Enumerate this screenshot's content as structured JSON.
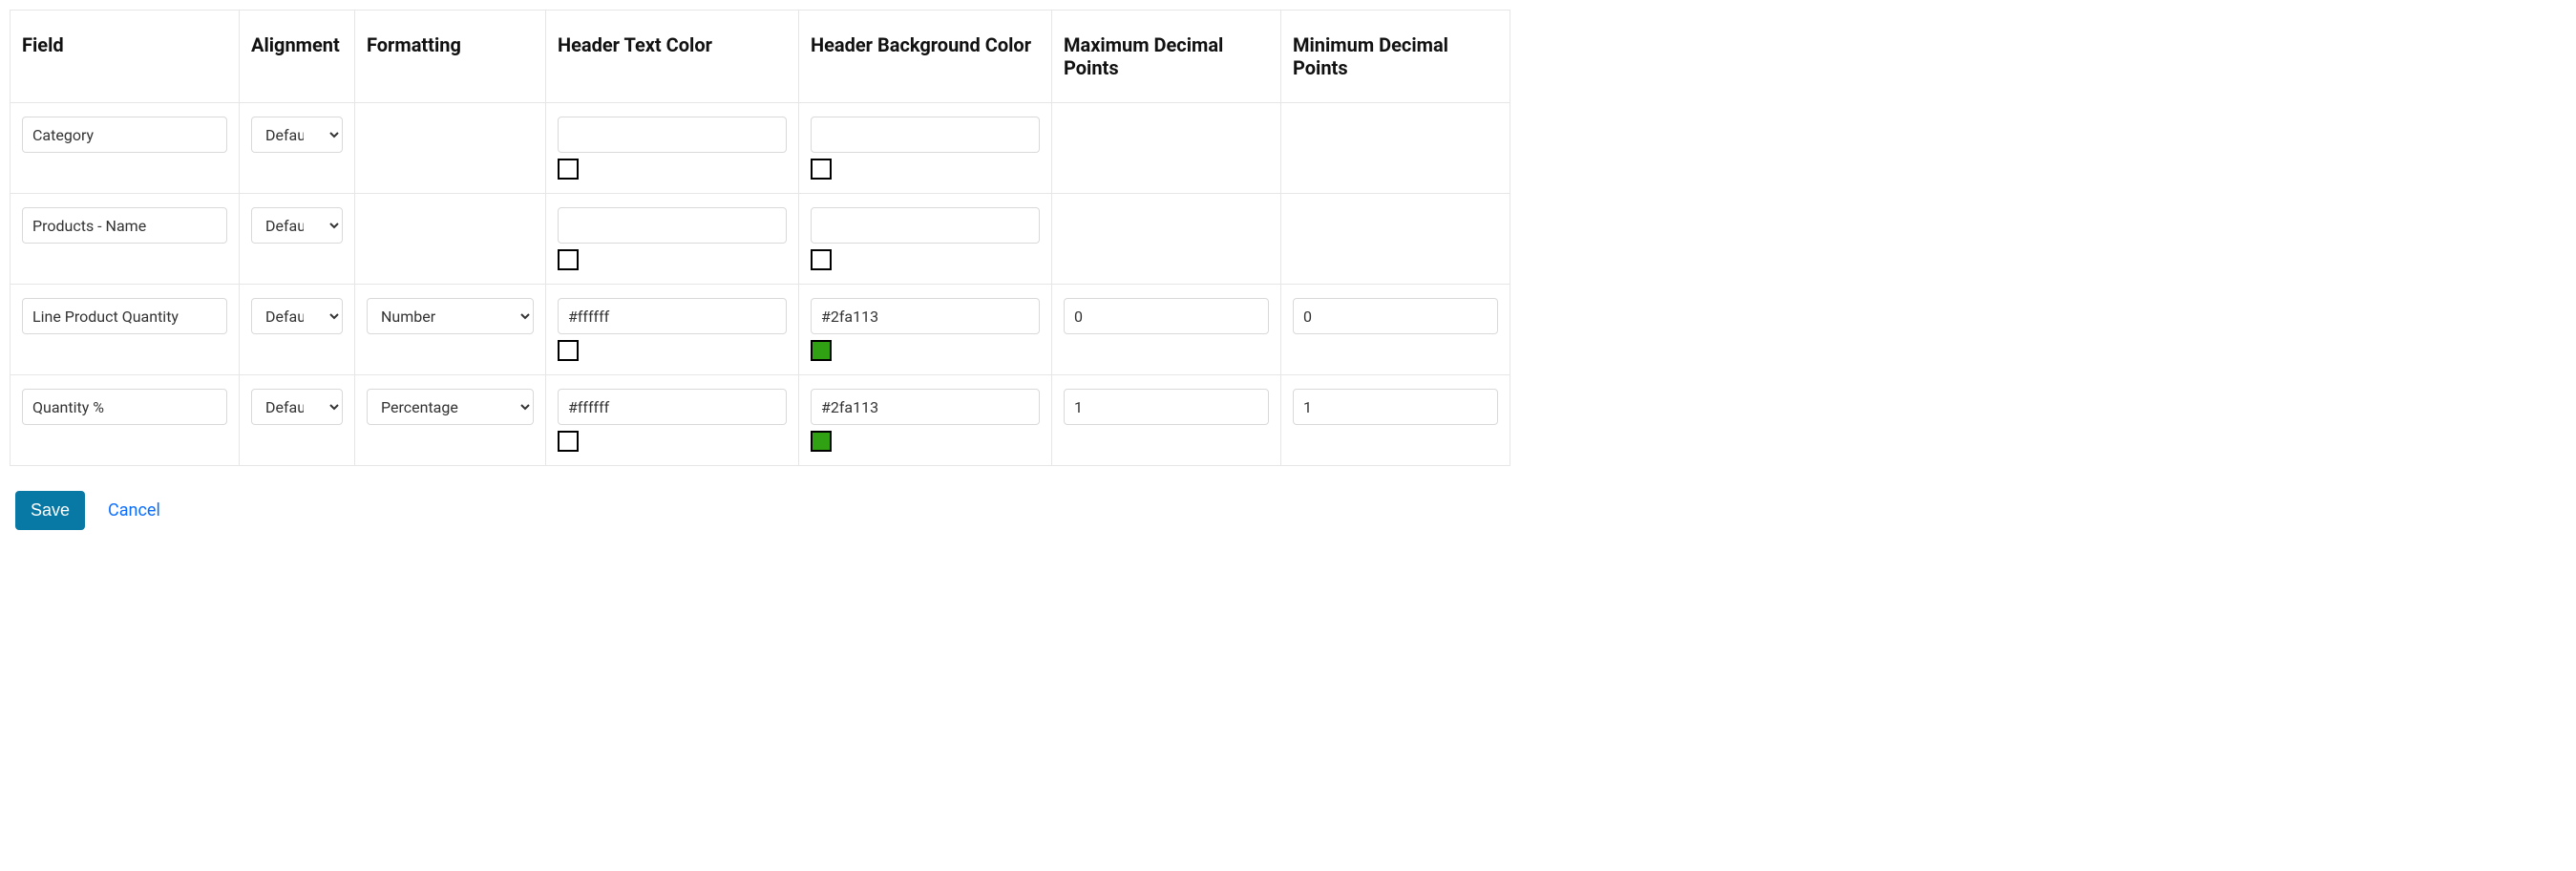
{
  "headers": {
    "field": "Field",
    "alignment": "Alignment",
    "formatting": "Formatting",
    "header_text_color": "Header Text Color",
    "header_bg_color": "Header Background Color",
    "max_dp": "Maximum Decimal Points",
    "min_dp": "Minimum Decimal Points"
  },
  "rows": [
    {
      "field": "Category",
      "alignment": "Default",
      "formatting": "",
      "htc": "",
      "hbc": "",
      "htc_swatch": "#ffffff",
      "hbc_swatch": "#ffffff",
      "max": "",
      "min": ""
    },
    {
      "field": "Products - Name",
      "alignment": "Default",
      "formatting": "",
      "htc": "",
      "hbc": "",
      "htc_swatch": "#ffffff",
      "hbc_swatch": "#ffffff",
      "max": "",
      "min": ""
    },
    {
      "field": "Line Product Quantity",
      "alignment": "Default",
      "formatting": "Number",
      "htc": "#ffffff",
      "hbc": "#2fa113",
      "htc_swatch": "#ffffff",
      "hbc_swatch": "#2fa113",
      "max": "0",
      "min": "0"
    },
    {
      "field": "Quantity %",
      "alignment": "Default",
      "formatting": "Percentage",
      "htc": "#ffffff",
      "hbc": "#2fa113",
      "htc_swatch": "#ffffff",
      "hbc_swatch": "#2fa113",
      "max": "1",
      "min": "1"
    }
  ],
  "actions": {
    "save": "Save",
    "cancel": "Cancel"
  }
}
